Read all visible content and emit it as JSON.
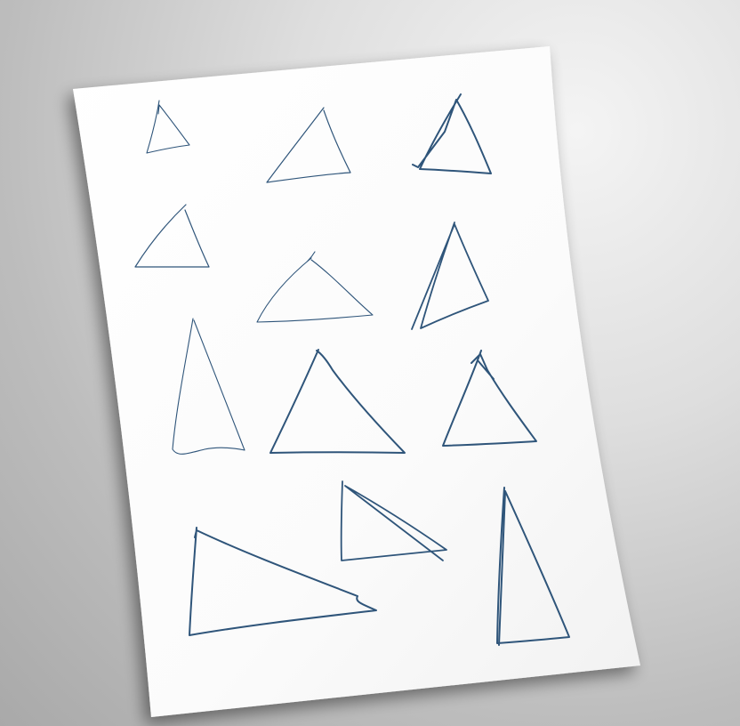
{
  "scene": {
    "description_free": true,
    "background_color": "#c9c9c9",
    "paper_color": "#fdfdfd",
    "ink_color": "#2f557a"
  },
  "sketches": [
    {
      "id": "sketch-1",
      "shape": "acute-triangle",
      "stroke": "thin"
    },
    {
      "id": "sketch-2",
      "shape": "acute-triangle",
      "stroke": "thin"
    },
    {
      "id": "sketch-3",
      "shape": "acute-triangle",
      "stroke": "bold"
    },
    {
      "id": "sketch-4",
      "shape": "acute-triangle",
      "stroke": "thin"
    },
    {
      "id": "sketch-5",
      "shape": "obtuse-triangle",
      "stroke": "thin"
    },
    {
      "id": "sketch-6",
      "shape": "acute-triangle",
      "stroke": "bold"
    },
    {
      "id": "sketch-7",
      "shape": "tall-triangle",
      "stroke": "thin"
    },
    {
      "id": "sketch-8",
      "shape": "acute-triangle",
      "stroke": "bold"
    },
    {
      "id": "sketch-9",
      "shape": "acute-triangle",
      "stroke": "bold"
    },
    {
      "id": "sketch-10",
      "shape": "right-triangle",
      "stroke": "bold"
    },
    {
      "id": "sketch-11",
      "shape": "obtuse-triangle",
      "stroke": "bold"
    },
    {
      "id": "sketch-12",
      "shape": "tall-right-triangle",
      "stroke": "bold"
    }
  ]
}
